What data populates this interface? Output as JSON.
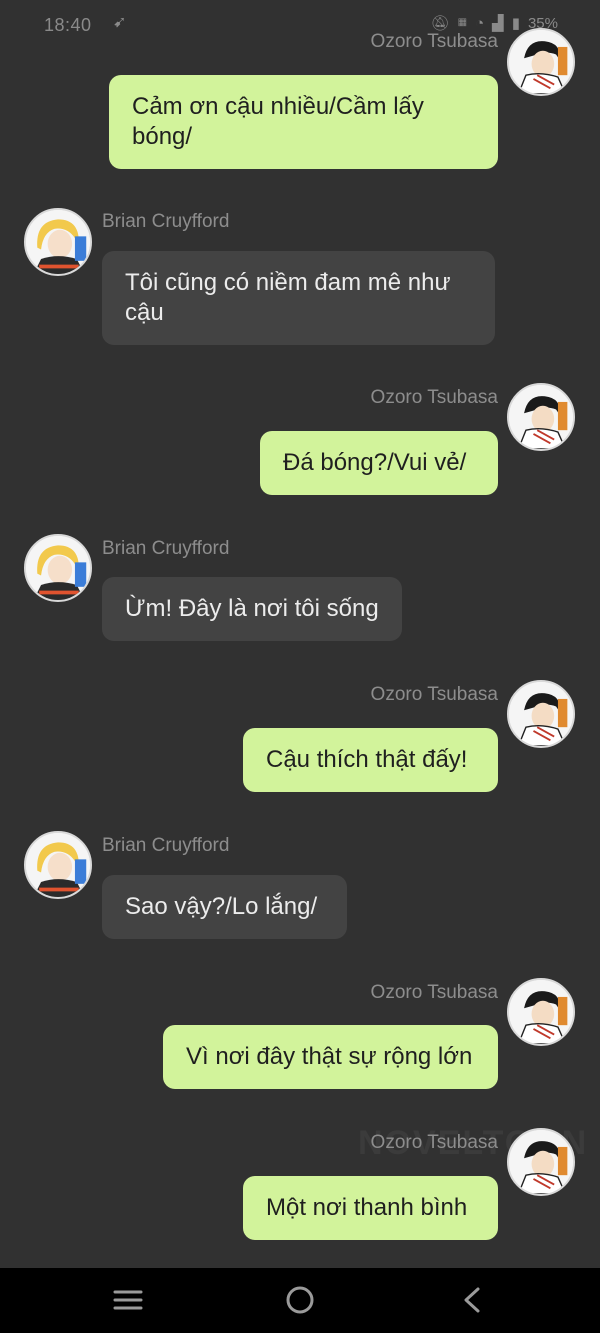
{
  "status_bar": {
    "time": "18:40",
    "battery": "35%",
    "icons": [
      "notification-icon",
      "mute-icon",
      "lte-icon",
      "wifi-icon",
      "signal-icon",
      "battery-icon"
    ]
  },
  "watermark": "NOVELTOON",
  "messages": [
    {
      "sender": "Ozoro Tsubasa",
      "side": "right",
      "lines": [
        "Cảm ơn cậu nhiều/Cầm lấy",
        "bóng/"
      ]
    },
    {
      "sender": "Brian Cruyfford",
      "side": "left",
      "lines": [
        "Tôi cũng có niềm đam mê như",
        "cậu"
      ]
    },
    {
      "sender": "Ozoro Tsubasa",
      "side": "right",
      "lines": [
        "Đá bóng?/Vui vẻ/"
      ]
    },
    {
      "sender": "Brian Cruyfford",
      "side": "left",
      "lines": [
        "Ừm! Đây là nơi tôi sống"
      ]
    },
    {
      "sender": "Ozoro Tsubasa",
      "side": "right",
      "lines": [
        "Cậu thích thật đấy!"
      ]
    },
    {
      "sender": "Brian Cruyfford",
      "side": "left",
      "lines": [
        "Sao vậy?/Lo lắng/"
      ]
    },
    {
      "sender": "Ozoro Tsubasa",
      "side": "right",
      "lines": [
        "Vì nơi đây thật sự rộng lớn"
      ]
    },
    {
      "sender": "Ozoro Tsubasa",
      "side": "right",
      "lines": [
        "Một nơi thanh bình"
      ]
    }
  ],
  "colors": {
    "background": "#313131",
    "outgoing_bubble": "#d2f39b",
    "incoming_bubble": "#434343",
    "name_text": "#8d8d8d"
  },
  "nav": {
    "recent_apps": "menu-icon",
    "home": "home-circle-icon",
    "back": "back-chevron-icon"
  }
}
